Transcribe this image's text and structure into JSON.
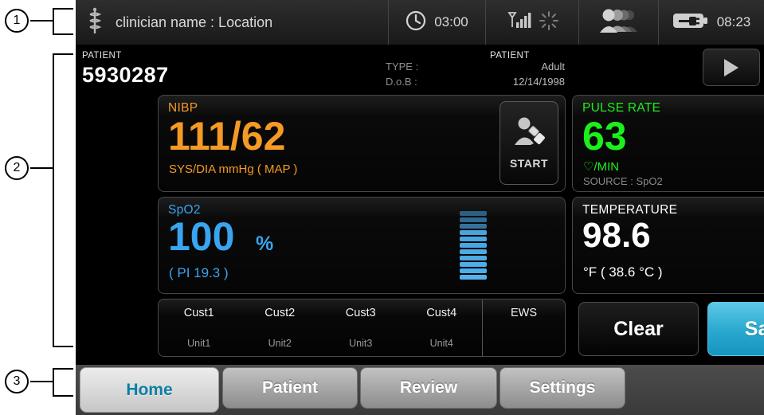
{
  "callouts": [
    {
      "number": "1"
    },
    {
      "number": "2"
    },
    {
      "number": "3"
    }
  ],
  "statusbar": {
    "clinician_icon": "caduceus-icon",
    "clinician_text": "clinician name : Location",
    "timer_icon": "clock-icon",
    "timer_value": "03:00",
    "signal_icon": "wifi-signal-icon",
    "activity_icon": "spinner-icon",
    "users_icon": "patients-icon",
    "battery_icon": "battery-charging-icon",
    "battery_value": "08:23"
  },
  "patient_header": {
    "label": "PATIENT",
    "id": "5930287",
    "type_key": "TYPE :",
    "type_value": "Adult",
    "dob_key": "D.o.B :",
    "dob_value": "12/14/1998",
    "right_label": "PATIENT",
    "play_icon": "play-icon"
  },
  "vitals": {
    "nibp": {
      "title": "NIBP",
      "value": "111/62",
      "unit": "SYS/DIA mmHg ( MAP )",
      "color": "#f59a24",
      "start_label": "START",
      "start_icon": "patient-cuff-icon"
    },
    "pulse": {
      "title": "PULSE RATE",
      "value": "63",
      "unit": "♡/MIN",
      "source": "SOURCE : SpO2",
      "color": "#1bf01b"
    },
    "spo2": {
      "title": "SpO2",
      "value": "100",
      "percent": "%",
      "pi": "( PI 19.3 )",
      "color": "#39a5f0",
      "bar_icon": "pulse-amplitude-bar",
      "bar_segments": 11,
      "bar_dim_count": 3
    },
    "temperature": {
      "title": "TEMPERATURE",
      "value": "98.6",
      "unit": "°F  ( 38.6 °C )",
      "color": "#ffffff",
      "icon": "patient-thermometer-icon"
    }
  },
  "custom_row": {
    "cells": [
      {
        "name": "Cust1",
        "unit": "Unit1"
      },
      {
        "name": "Cust2",
        "unit": "Unit2"
      },
      {
        "name": "Cust3",
        "unit": "Unit3"
      },
      {
        "name": "Cust4",
        "unit": "Unit4"
      }
    ],
    "ews_label": "EWS"
  },
  "actions": {
    "clear_label": "Clear",
    "save_label": "Save",
    "save_color": "#28a8cf"
  },
  "tabs": [
    {
      "label": "Home",
      "active": true
    },
    {
      "label": "Patient",
      "active": false
    },
    {
      "label": "Review",
      "active": false
    },
    {
      "label": "Settings",
      "active": false
    }
  ]
}
